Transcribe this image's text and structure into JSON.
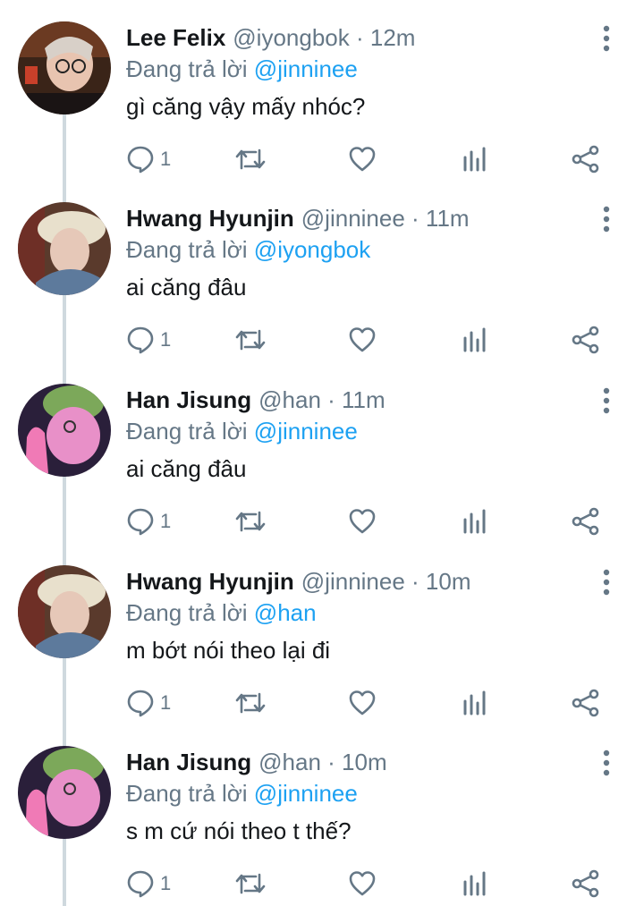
{
  "reply_prefix": "Đang trả lời",
  "tweets": [
    {
      "name": "Lee Felix",
      "handle": "@iyongbok · 12m",
      "reply_to": "@jinninee",
      "text": "gì căng vậy mấy nhóc?",
      "reply_count": "1",
      "avatar": "lee-felix"
    },
    {
      "name": "Hwang Hyunjin",
      "handle": "@jinninee · 11m",
      "reply_to": "@iyongbok",
      "text": "ai căng đâu",
      "reply_count": "1",
      "avatar": "hwang-hyunjin"
    },
    {
      "name": "Han Jisung",
      "handle": "@han · 11m",
      "reply_to": "@jinninee",
      "text": "ai căng đâu",
      "reply_count": "1",
      "avatar": "han-jisung"
    },
    {
      "name": "Hwang Hyunjin",
      "handle": "@jinninee · 10m",
      "reply_to": "@han",
      "text": "m bớt nói theo lại đi",
      "reply_count": "1",
      "avatar": "hwang-hyunjin"
    },
    {
      "name": "Han Jisung",
      "handle": "@han · 10m",
      "reply_to": "@jinninee",
      "text": "s m cứ nói theo t thế?",
      "reply_count": "1",
      "avatar": "han-jisung"
    }
  ],
  "icons": {
    "more": "more-vertical-icon",
    "reply": "reply-icon",
    "retweet": "retweet-icon",
    "like": "heart-icon",
    "stats": "analytics-icon",
    "share": "share-icon"
  },
  "colors": {
    "name": "#14171a",
    "secondary": "#657786",
    "link": "#1da1f2",
    "thread_line": "#cfd9de"
  }
}
